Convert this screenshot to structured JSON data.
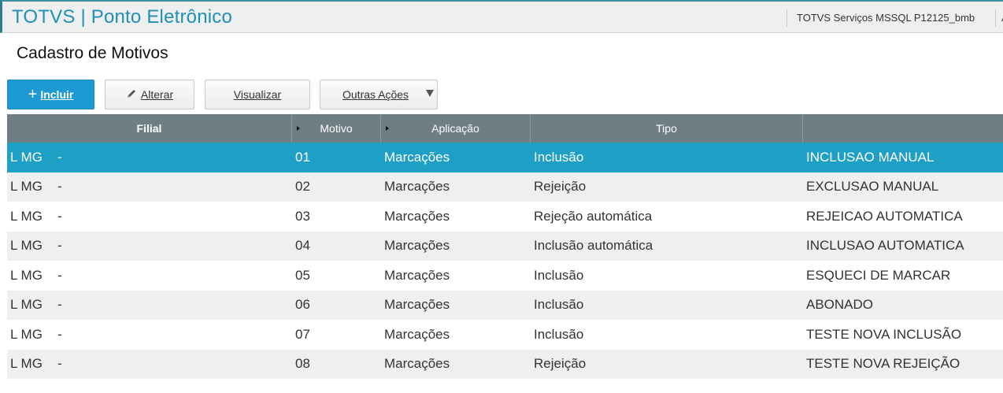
{
  "header": {
    "app_title": "TOTVS | Ponto Eletrônico",
    "environment": "TOTVS Serviços MSSQL P12125_bmb",
    "more": "A"
  },
  "page": {
    "title": "Cadastro de Motivos"
  },
  "toolbar": {
    "incluir": "Incluir",
    "alterar": "Alterar",
    "visualizar": "Visualizar",
    "outras_acoes": "Outras Ações"
  },
  "grid": {
    "columns": [
      "Filial",
      "Motivo",
      "Aplicação",
      "Tipo",
      ""
    ],
    "rows": [
      {
        "filial": "L MG",
        "dash": "-",
        "motivo": "01",
        "aplicacao": "Marcações",
        "tipo": "Inclusão",
        "descricao": "INCLUSAO MANUAL"
      },
      {
        "filial": "L MG",
        "dash": "-",
        "motivo": "02",
        "aplicacao": "Marcações",
        "tipo": "Rejeição",
        "descricao": "EXCLUSAO MANUAL"
      },
      {
        "filial": "L MG",
        "dash": "-",
        "motivo": "03",
        "aplicacao": "Marcações",
        "tipo": "Rejeção automática",
        "descricao": "REJEICAO AUTOMATICA"
      },
      {
        "filial": "L MG",
        "dash": "-",
        "motivo": "04",
        "aplicacao": "Marcações",
        "tipo": "Inclusão automática",
        "descricao": "INCLUSAO AUTOMATICA"
      },
      {
        "filial": "L MG",
        "dash": "-",
        "motivo": "05",
        "aplicacao": "Marcações",
        "tipo": "Inclusão",
        "descricao": "ESQUECI DE MARCAR"
      },
      {
        "filial": "L MG",
        "dash": "-",
        "motivo": "06",
        "aplicacao": "Marcações",
        "tipo": "Inclusão",
        "descricao": "ABONADO"
      },
      {
        "filial": "L MG",
        "dash": "-",
        "motivo": "07",
        "aplicacao": "Marcações",
        "tipo": "Inclusão",
        "descricao": "TESTE NOVA INCLUSÃO"
      },
      {
        "filial": "L MG",
        "dash": "-",
        "motivo": "08",
        "aplicacao": "Marcações",
        "tipo": "Rejeição",
        "descricao": "TESTE NOVA REJEIÇÃO"
      }
    ]
  },
  "icons": {
    "incluir": "plus-icon",
    "alterar": "pencil-icon",
    "outras": "caret-down-icon"
  },
  "colors": {
    "brand": "#1f8fb6",
    "primary_button": "#1c9ad1",
    "header_grid": "#6f7d85",
    "selected_row": "#1e9fc5"
  }
}
